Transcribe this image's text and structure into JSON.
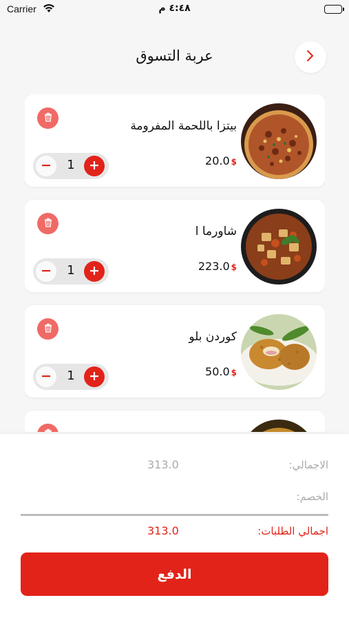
{
  "status_bar": {
    "carrier": "Carrier",
    "time": "٤:٤٨ م"
  },
  "header": {
    "title": "عربة التسوق"
  },
  "cart": {
    "items": [
      {
        "name": "بيتزا باللحمة المفرومة",
        "price": "20.0",
        "currency": "$",
        "quantity": "1"
      },
      {
        "name": "شاورما ا",
        "price": "223.0",
        "currency": "$",
        "quantity": "1"
      },
      {
        "name": "كوردن بلو",
        "price": "50.0",
        "currency": "$",
        "quantity": "1"
      }
    ]
  },
  "summary": {
    "total_label": "الاجمالي:",
    "total_value": "313.0",
    "discount_label": "الخصم:",
    "grand_total_label": "اجمالي الطلبات:",
    "grand_total_value": "313.0"
  },
  "pay_button": {
    "label": "الدفع"
  },
  "colors": {
    "accent": "#e2231a",
    "trash": "#f06a66",
    "background": "#f6f6f6"
  }
}
